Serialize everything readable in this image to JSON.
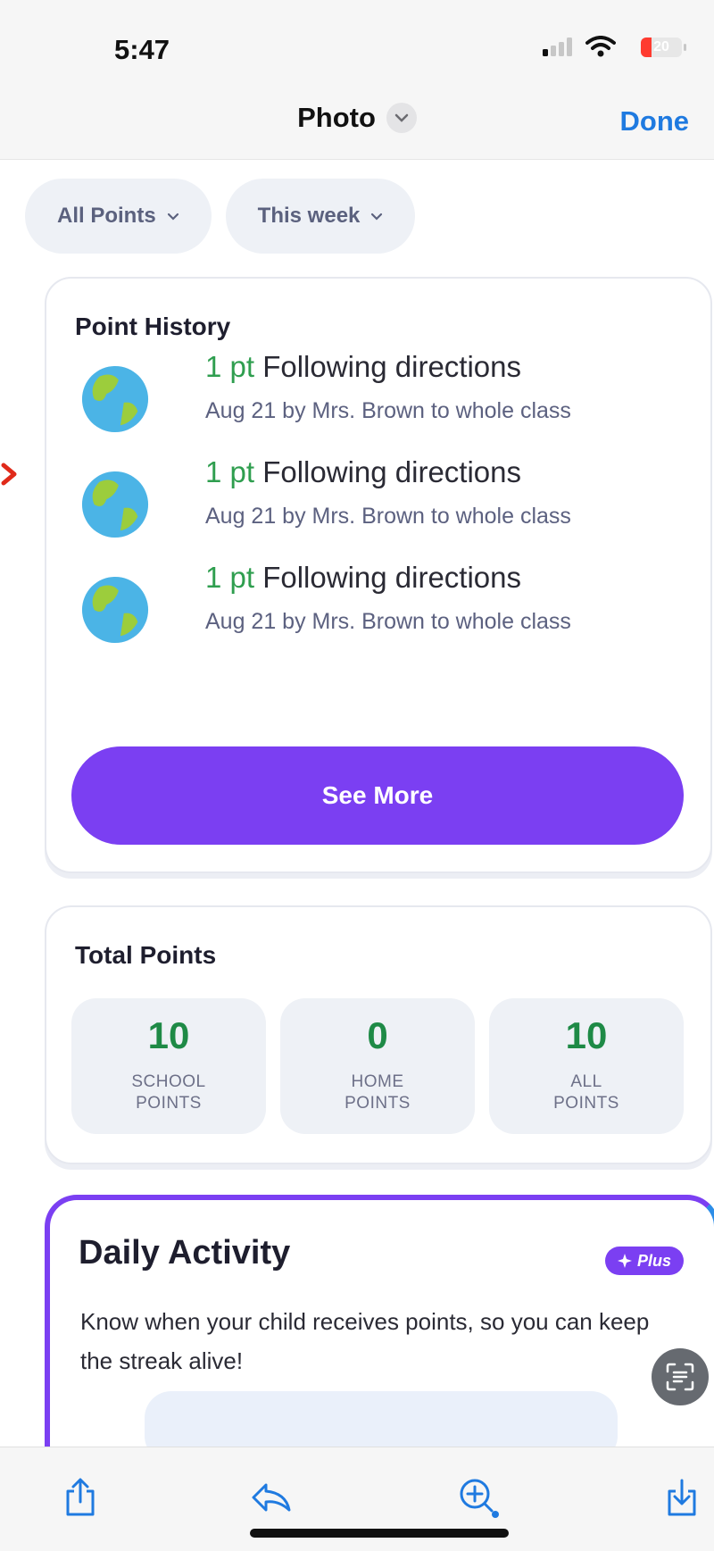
{
  "status": {
    "time": "5:47",
    "battery": "20"
  },
  "nav": {
    "title": "Photo",
    "done_label": "Done"
  },
  "filters": {
    "points": "All Points",
    "period": "This week"
  },
  "history": {
    "title": "Point History",
    "items": [
      {
        "pts": "1 pt",
        "label": "Following directions",
        "meta": "Aug 21 by Mrs. Brown to whole class"
      },
      {
        "pts": "1 pt",
        "label": "Following directions",
        "meta": "Aug 21 by Mrs. Brown to whole class"
      },
      {
        "pts": "1 pt",
        "label": "Following directions",
        "meta": "Aug 21 by Mrs. Brown to whole class"
      }
    ],
    "see_more": "See More"
  },
  "totals": {
    "title": "Total Points",
    "stats": [
      {
        "value": "10",
        "label1": "SCHOOL",
        "label2": "POINTS"
      },
      {
        "value": "0",
        "label1": "HOME",
        "label2": "POINTS"
      },
      {
        "value": "10",
        "label1": "ALL",
        "label2": "POINTS"
      }
    ]
  },
  "daily": {
    "title": "Daily Activity",
    "badge": "Plus",
    "description": "Know when your child receives points, so you can keep the streak alive!"
  },
  "toolbar": {
    "icons": [
      "share-icon",
      "reply-icon",
      "zoom-icon",
      "save-icon"
    ]
  },
  "colors": {
    "accent": "#7b3ff2",
    "link": "#1f7ae0",
    "points_green": "#2f9e4f"
  }
}
